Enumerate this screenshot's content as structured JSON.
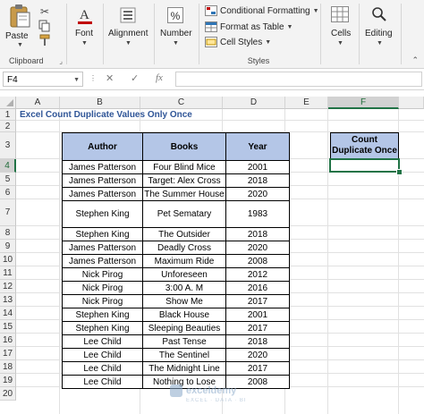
{
  "ribbon": {
    "clipboard": {
      "paste_label": "Paste",
      "group_label": "Clipboard"
    },
    "font": {
      "label": "Font"
    },
    "alignment": {
      "label": "Alignment"
    },
    "number": {
      "label": "Number",
      "percent_symbol": "%"
    },
    "styles": {
      "conditional_formatting": "Conditional Formatting",
      "format_as_table": "Format as Table",
      "cell_styles": "Cell Styles",
      "group_label": "Styles"
    },
    "cells": {
      "label": "Cells"
    },
    "editing": {
      "label": "Editing"
    }
  },
  "formula_bar": {
    "name_box": "F4",
    "cancel_symbol": "✕",
    "enter_symbol": "✓",
    "fx_symbol": "fx",
    "content": ""
  },
  "sheet": {
    "columns": [
      "A",
      "B",
      "C",
      "D",
      "E",
      "F"
    ],
    "rows": [
      "1",
      "2",
      "3",
      "4",
      "5",
      "6",
      "7",
      "8",
      "9",
      "10",
      "11",
      "12",
      "13",
      "14",
      "15",
      "16",
      "17",
      "18",
      "19",
      "20"
    ],
    "selected_cell": "F4",
    "title": "Excel Count Duplicate Values Only Once",
    "table_headers": [
      "Author",
      "Books",
      "Year"
    ],
    "table_rows": [
      [
        "James Patterson",
        "Four Blind Mice",
        "2001"
      ],
      [
        "James Patterson",
        "Target: Alex Cross",
        "2018"
      ],
      [
        "James Patterson",
        "The Summer House",
        "2020"
      ],
      [
        "Stephen King",
        "Pet Sematary",
        "1983"
      ],
      [
        "Stephen King",
        "The Outsider",
        "2018"
      ],
      [
        "James Patterson",
        "Deadly Cross",
        "2020"
      ],
      [
        "James Patterson",
        "Maximum Ride",
        "2008"
      ],
      [
        "Nick Pirog",
        "Unforeseen",
        "2012"
      ],
      [
        "Nick Pirog",
        "3:00 A. M",
        "2016"
      ],
      [
        "Nick Pirog",
        "Show Me",
        "2017"
      ],
      [
        "Stephen King",
        "Black House",
        "2001"
      ],
      [
        "Stephen King",
        "Sleeping Beauties",
        "2017"
      ],
      [
        "Lee Child",
        "Past Tense",
        "2018"
      ],
      [
        "Lee Child",
        "The Sentinel",
        "2020"
      ],
      [
        "Lee Child",
        "The Midnight Line",
        "2017"
      ],
      [
        "Lee Child",
        "Nothing to Lose",
        "2008"
      ]
    ],
    "count_header_line1": "Count",
    "count_header_line2": "Duplicate Once"
  },
  "watermark": {
    "name": "exceldemy",
    "tagline": "EXCEL · DATA · BI"
  },
  "colors": {
    "accent_green": "#217346",
    "header_fill": "#b4c6e7",
    "title_blue": "#2f5597"
  }
}
